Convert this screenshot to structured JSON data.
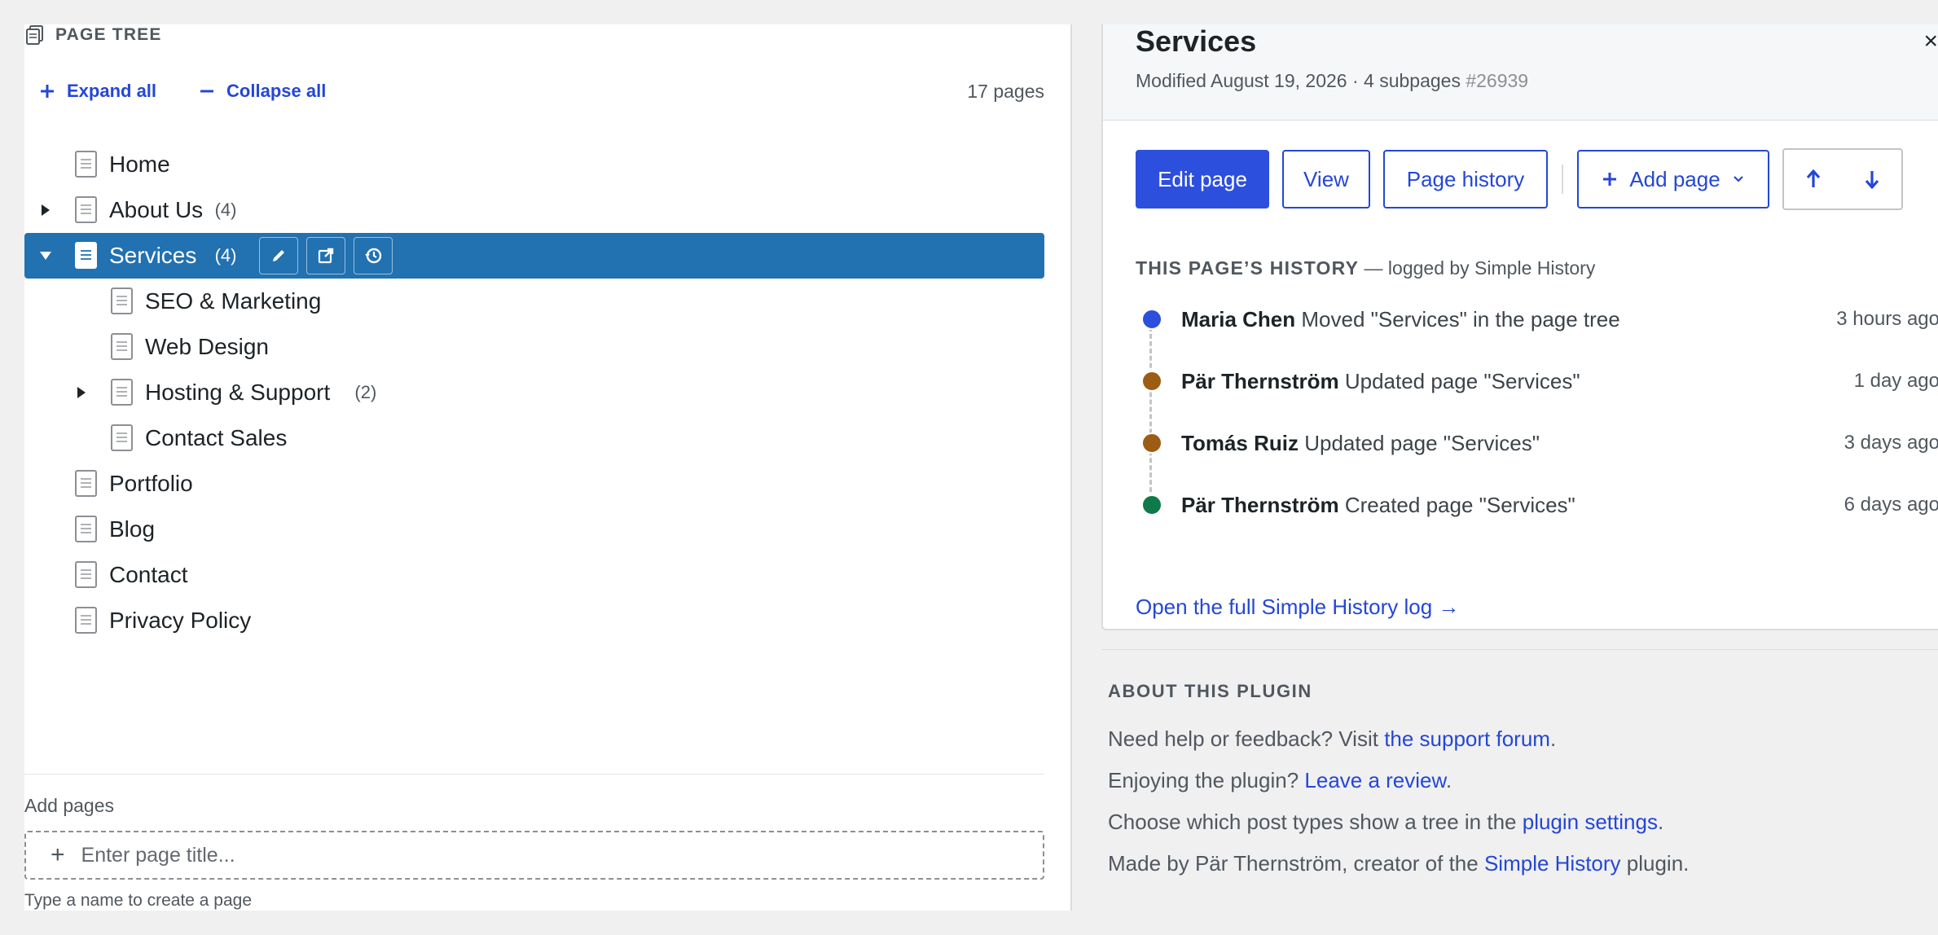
{
  "left": {
    "header": "PAGE TREE",
    "expand_all": "Expand all",
    "collapse_all": "Collapse all",
    "page_count": "17 pages",
    "tree": [
      {
        "label": "Home",
        "count": "",
        "depth": 0,
        "toggle": "none",
        "selected": false
      },
      {
        "label": "About Us",
        "count": "(4)",
        "depth": 0,
        "toggle": "collapsed",
        "selected": false
      },
      {
        "label": "Services",
        "count": "(4)",
        "depth": 0,
        "toggle": "expanded",
        "selected": true
      },
      {
        "label": "SEO & Marketing",
        "count": "",
        "depth": 1,
        "toggle": "none",
        "selected": false
      },
      {
        "label": "Web Design",
        "count": "",
        "depth": 1,
        "toggle": "none",
        "selected": false
      },
      {
        "label": "Hosting & Support",
        "count": "(2)",
        "depth": 1,
        "toggle": "collapsed",
        "selected": false
      },
      {
        "label": "Contact Sales",
        "count": "",
        "depth": 1,
        "toggle": "none",
        "selected": false
      },
      {
        "label": "Portfolio",
        "count": "",
        "depth": 0,
        "toggle": "none",
        "selected": false
      },
      {
        "label": "Blog",
        "count": "",
        "depth": 0,
        "toggle": "none",
        "selected": false
      },
      {
        "label": "Contact",
        "count": "",
        "depth": 0,
        "toggle": "none",
        "selected": false
      },
      {
        "label": "Privacy Policy",
        "count": "",
        "depth": 0,
        "toggle": "none",
        "selected": false
      }
    ],
    "row_action_icons": [
      "pencil-icon",
      "external-link-icon",
      "history-icon"
    ],
    "add_pages": {
      "label": "Add pages",
      "plus": "+",
      "placeholder": "Enter page title...",
      "hint": "Type a name to create a page"
    }
  },
  "detail": {
    "title": "Services",
    "meta": "Modified August 19, 2026 · 4 subpages",
    "page_id": "#26939",
    "close": "×",
    "buttons": {
      "edit": "Edit page",
      "view": "View",
      "history": "Page history",
      "add": "Add page"
    },
    "history_heading": "THIS PAGE’S HISTORY",
    "history_sub": "— logged by Simple History",
    "events": [
      {
        "user": "Maria Chen",
        "action": "Moved \"Services\" in the page tree",
        "time": "3 hours ago",
        "color": "#2c4fde"
      },
      {
        "user": "Pär Thernström",
        "action": "Updated page \"Services\"",
        "time": "1 day ago",
        "color": "#9c5c13"
      },
      {
        "user": "Tomás Ruiz",
        "action": "Updated page \"Services\"",
        "time": "3 days ago",
        "color": "#9c5c13"
      },
      {
        "user": "Pär Thernström",
        "action": "Created page \"Services\"",
        "time": "6 days ago",
        "color": "#0e7a4a"
      }
    ],
    "full_log": "Open the full Simple History log →"
  },
  "about": {
    "title": "ABOUT THIS PLUGIN",
    "l1_text": "Need help or feedback? Visit ",
    "l1_link": "the support forum",
    "l1_end": ".",
    "l2_text": "Enjoying the plugin? ",
    "l2_link": "Leave a review",
    "l2_end": ".",
    "l3_text": "Choose which post types show a tree in the ",
    "l3_link": "plugin settings",
    "l3_end": ".",
    "l4_text": "Made by Pär Thernström, creator of the ",
    "l4_link": "Simple History",
    "l4_end": " plugin."
  },
  "colors": {
    "accent": "#2447d6",
    "primary_button": "#2c4fde",
    "selected_row": "#2271b1"
  }
}
